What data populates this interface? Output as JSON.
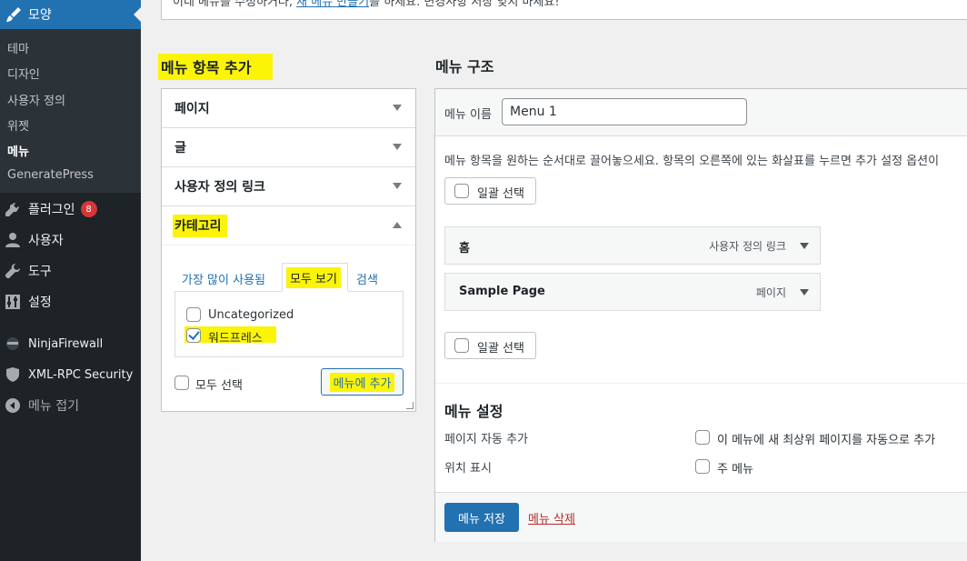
{
  "sidebar": {
    "current": {
      "label": "모양",
      "icon": "paintbrush-icon"
    },
    "submenu": [
      {
        "label": "테마"
      },
      {
        "label": "디자인"
      },
      {
        "label": "사용자 정의"
      },
      {
        "label": "위젯"
      },
      {
        "label": "메뉴",
        "active": true
      },
      {
        "label": "GeneratePress"
      }
    ],
    "items": [
      {
        "label": "플러그인",
        "icon": "plug-icon",
        "badge": "8"
      },
      {
        "label": "사용자",
        "icon": "user-icon"
      },
      {
        "label": "도구",
        "icon": "wrench-icon"
      },
      {
        "label": "설정",
        "icon": "sliders-icon"
      },
      {
        "label": "NinjaFirewall",
        "icon": "ninja-icon"
      },
      {
        "label": "XML-RPC Security",
        "icon": "shield-icon"
      },
      {
        "label": "메뉴 접기",
        "icon": "collapse-icon"
      }
    ]
  },
  "notice": {
    "before": "이네 메뉴를 수정하거나, ",
    "link": "새 메뉴 만들기",
    "after": "를 하세요. 변경사항 저장 잊지 마세요!"
  },
  "add_items": {
    "title": "메뉴 항목 추가",
    "sections": [
      {
        "label": "페이지"
      },
      {
        "label": "글"
      },
      {
        "label": "사용자 정의 링크"
      },
      {
        "label": "카테고리"
      }
    ],
    "tabs": {
      "popular": "가장 많이 사용됨",
      "all": "모두 보기",
      "search": "검색"
    },
    "categories": [
      {
        "label": "Uncategorized",
        "checked": false
      },
      {
        "label": "워드프레스",
        "checked": true
      }
    ],
    "select_all": "모두 선택",
    "add_button": "메뉴에 추가"
  },
  "structure": {
    "title": "메뉴 구조",
    "name_label": "메뉴 이름",
    "name_value": "Menu 1",
    "instructions": "메뉴 항목을 원하는 순서대로 끌어놓으세요. 항목의 오른쪽에 있는 화살표를 누르면 추가 설정 옵션이",
    "bulk_select": "일괄 선택",
    "menu_items": [
      {
        "title": "홈",
        "type": "사용자 정의 링크"
      },
      {
        "title": "Sample Page",
        "type": "페이지"
      }
    ],
    "settings": {
      "title": "메뉴 설정",
      "auto_add_label": "페이지 자동 추가",
      "auto_add_option": "이 메뉴에 새 최상위 페이지를 자동으로 추가",
      "location_label": "위치 표시",
      "location_option": "주 메뉴"
    },
    "save_button": "메뉴 저장",
    "delete_link": "메뉴 삭제"
  },
  "colors": {
    "sidebar_bg": "#1d2327",
    "accent": "#2271b1",
    "highlight": "#fbf407",
    "badge": "#d63638"
  }
}
